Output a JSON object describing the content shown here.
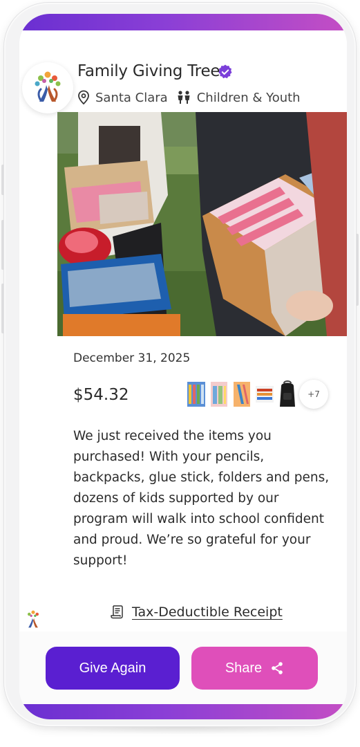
{
  "org": {
    "name": "Family Giving Tree",
    "location": "Santa Clara",
    "category": "Children & Youth"
  },
  "post": {
    "date": "December 31, 2025",
    "amount": "$54.32",
    "more_items": "+7",
    "message": "We just received the items you purchased! With your pencils, backpacks, glue stick, folders and pens, dozens of kids supported by our program will walk into school confident and proud. We’re so grateful for your support!",
    "receipt_label": "Tax-Deductible Receipt"
  },
  "actions": {
    "give_again": "Give Again",
    "share": "Share"
  },
  "colors": {
    "gradient_start": "#6a2fd1",
    "gradient_end": "#c44ec4",
    "give_button": "#5a1fd1",
    "share_button": "#df4fba",
    "verified": "#7b3fd9"
  },
  "icons": [
    "verified-badge-icon",
    "location-pin-icon",
    "people-icon",
    "receipt-icon",
    "share-icon"
  ]
}
